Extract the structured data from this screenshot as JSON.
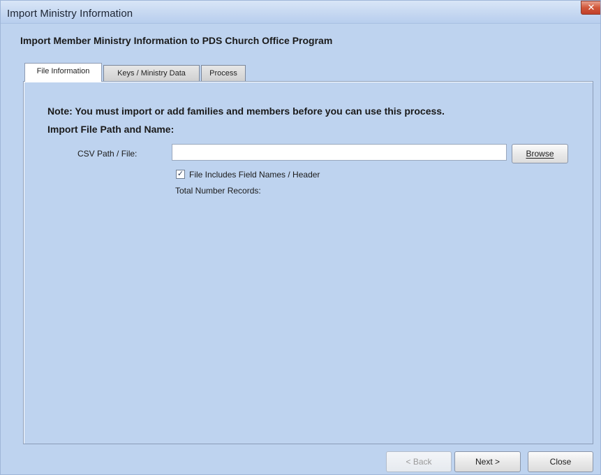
{
  "window": {
    "title": "Import Ministry Information",
    "close_glyph": "✕"
  },
  "heading": "Import Member Ministry Information to PDS Church Office Program",
  "tabs": [
    {
      "label": "File Information",
      "active": true
    },
    {
      "label": "Keys / Ministry Data",
      "active": false
    },
    {
      "label": "Process",
      "active": false
    }
  ],
  "file_info": {
    "note": "Note:  You must import or add families and members before you can use this process.",
    "section_label": "Import File Path and Name:",
    "csv_label": "CSV Path / File:",
    "csv_value": "",
    "browse_label": "Browse",
    "header_checkbox": {
      "checked": true,
      "check_glyph": "✓",
      "label": "File Includes Field Names / Header"
    },
    "total_records_label": "Total Number Records:"
  },
  "footer": {
    "back_label": "< Back",
    "back_enabled": false,
    "next_label": "Next >",
    "close_label": "Close"
  }
}
